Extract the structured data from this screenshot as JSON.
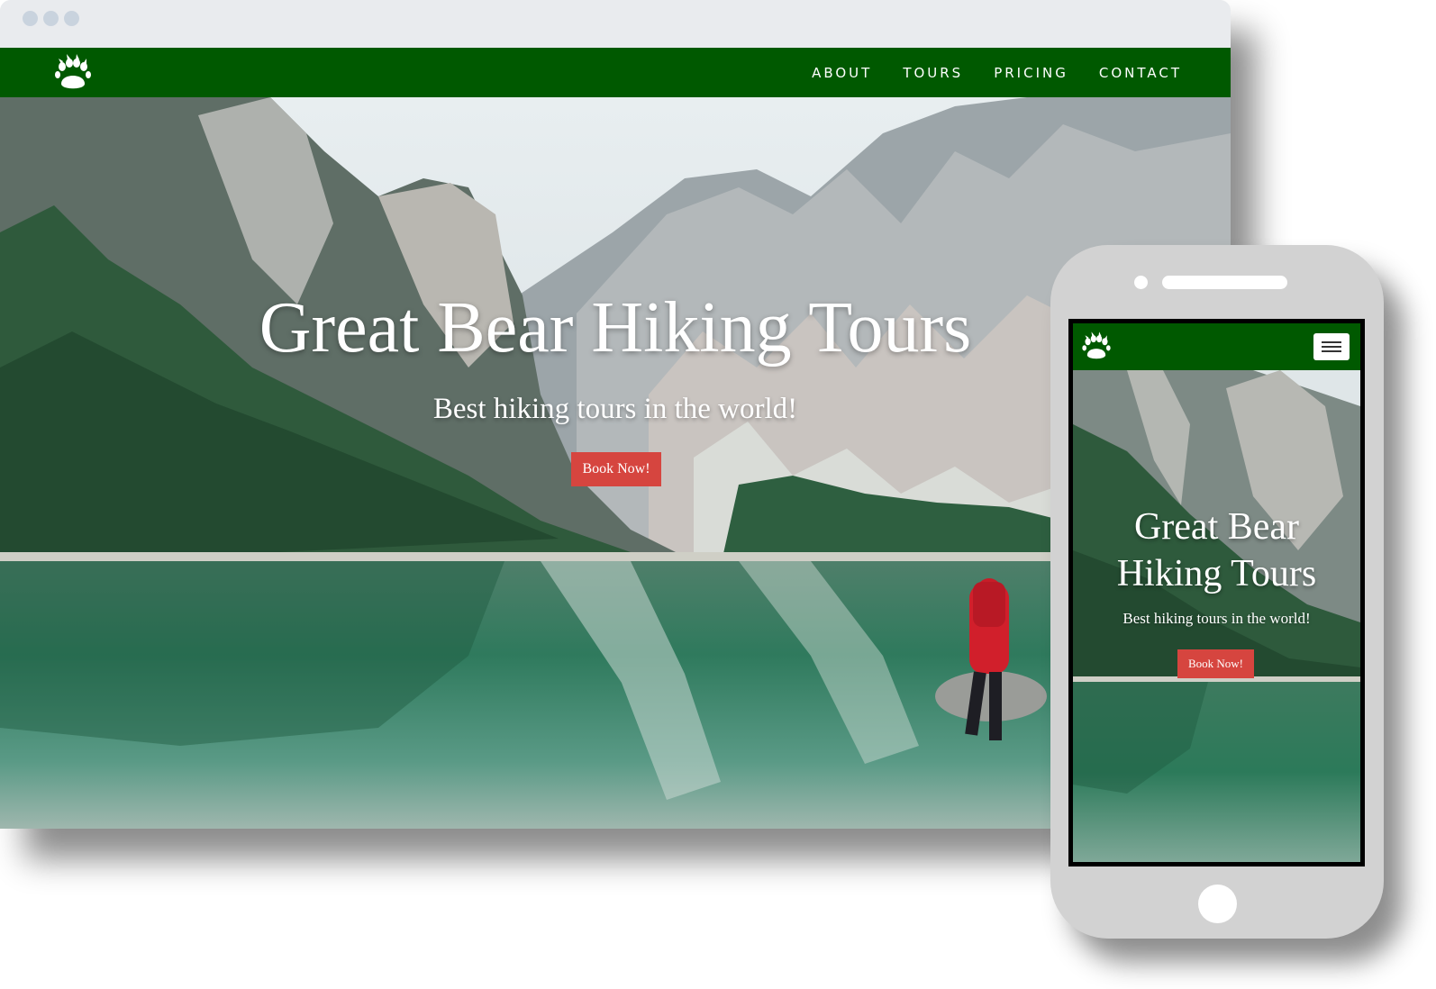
{
  "desktop": {
    "window_dots": [
      "close",
      "minimize",
      "maximize"
    ],
    "logo_icon": "bear-paw-icon",
    "nav": {
      "items": [
        "ABOUT",
        "TOURS",
        "PRICING",
        "CONTACT"
      ]
    },
    "hero": {
      "title": "Great Bear Hiking Tours",
      "subtitle": "Best hiking tours in the world!",
      "cta_label": "Book Now!"
    }
  },
  "mobile": {
    "logo_icon": "bear-paw-icon",
    "menu_icon": "hamburger-menu-icon",
    "hero": {
      "title_line1": "Great Bear",
      "title_line2": "Hiking Tours",
      "subtitle": "Best hiking tours in the world!",
      "cta_label": "Book Now!"
    }
  },
  "colors": {
    "nav_green": "#005900",
    "button_red": "#d6453f",
    "text_white": "#ffffff",
    "phone_frame": "#d2d2d2"
  }
}
